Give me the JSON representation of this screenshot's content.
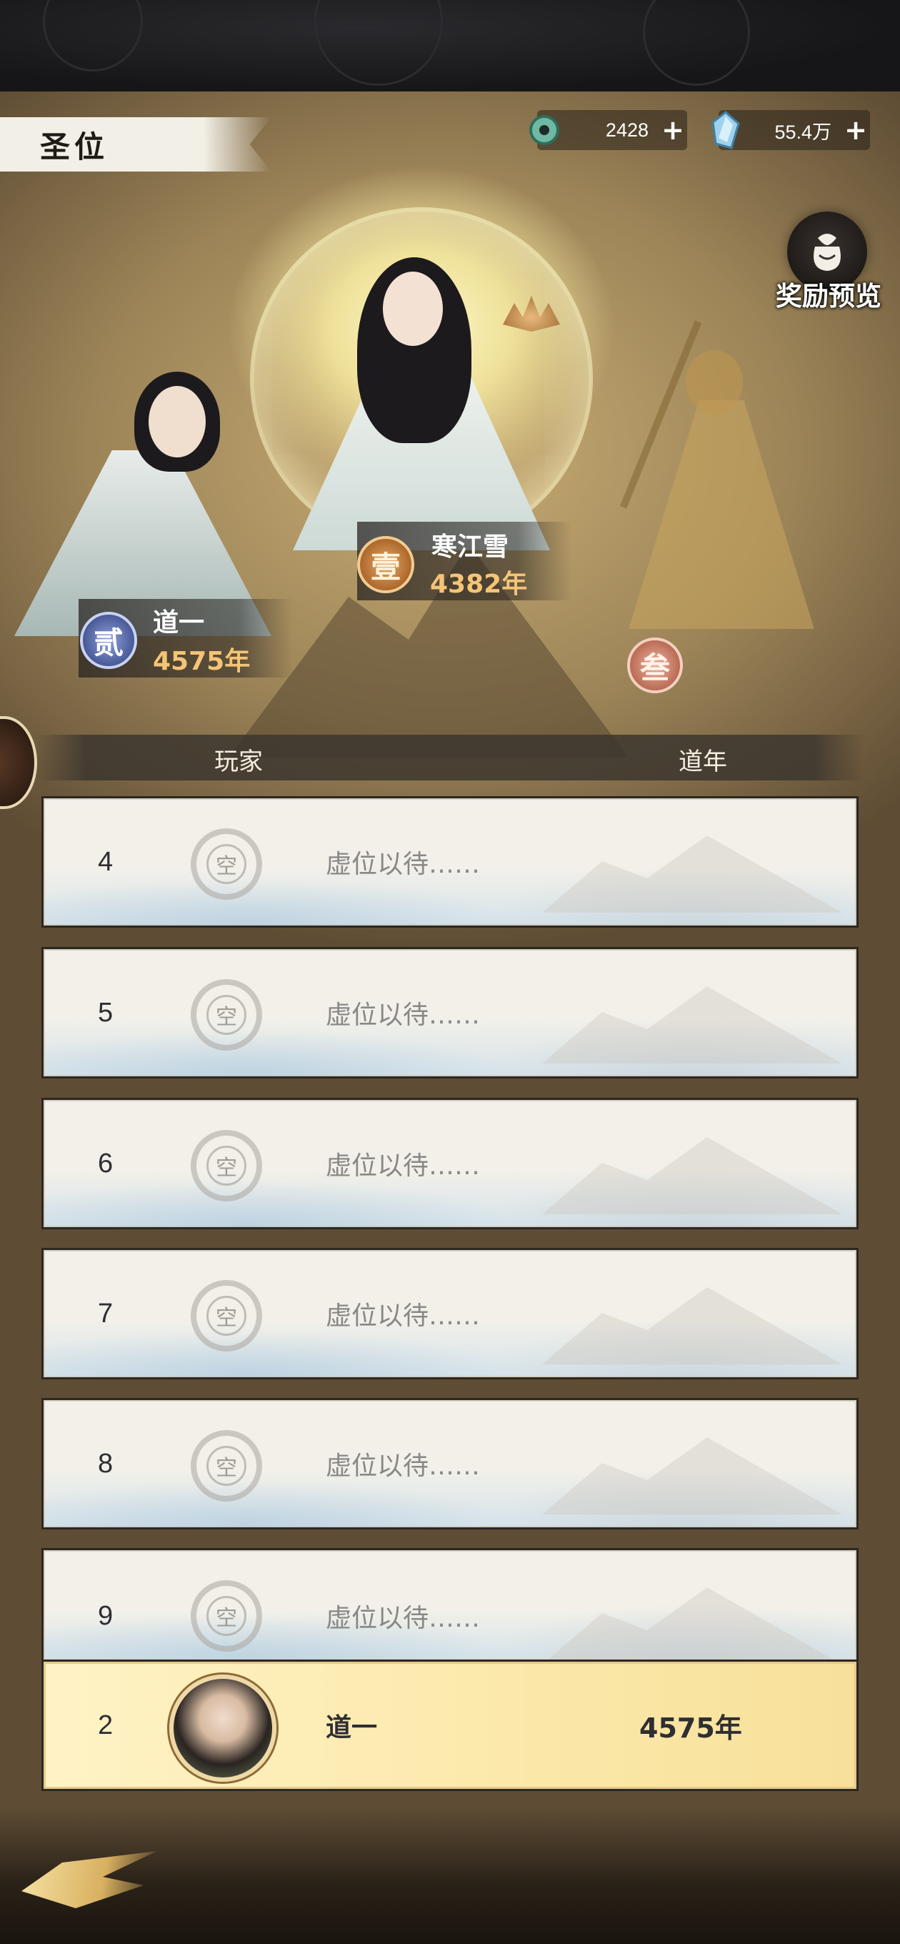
{
  "header": {
    "title": "圣位"
  },
  "currencies": [
    {
      "icon": "jade-coin-icon",
      "value": "2428"
    },
    {
      "icon": "spirit-crystal-icon",
      "value": "55.4万"
    }
  ],
  "reward_preview": {
    "label": "奖励预览",
    "icon": "gift-bag-icon"
  },
  "podium": {
    "first": {
      "medal": "壹",
      "name": "寒江雪",
      "years": "4382年"
    },
    "second": {
      "medal": "贰",
      "name": "道一",
      "years": "4575年"
    },
    "third": {
      "medal": "叁"
    }
  },
  "table": {
    "header_player": "玩家",
    "header_years": "道年",
    "empty_seal": "空",
    "rows": [
      {
        "rank": "4",
        "name": "虚位以待……"
      },
      {
        "rank": "5",
        "name": "虚位以待……"
      },
      {
        "rank": "6",
        "name": "虚位以待……"
      },
      {
        "rank": "7",
        "name": "虚位以待……"
      },
      {
        "rank": "8",
        "name": "虚位以待……"
      },
      {
        "rank": "9",
        "name": "虚位以待……"
      }
    ]
  },
  "my_rank": {
    "rank": "2",
    "name": "道一",
    "years": "4575年"
  },
  "colors": {
    "gold_text": "#f4c477",
    "row_bg": "#f2f0e9",
    "my_row_bg": "#fbe8a9"
  }
}
